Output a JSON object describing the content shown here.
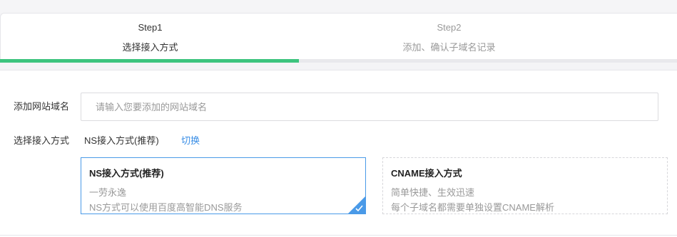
{
  "steps": [
    {
      "title": "Step1",
      "subtitle": "选择接入方式",
      "active": true
    },
    {
      "title": "Step2",
      "subtitle": "添加、确认子域名记录",
      "active": false
    }
  ],
  "progress": {
    "current_step": 1,
    "total_steps": 2,
    "color": "#3dc47e"
  },
  "form": {
    "domain_label": "添加网站域名",
    "domain_placeholder": "请输入您要添加的网站域名",
    "domain_value": "",
    "method_label": "选择接入方式",
    "method_value": "NS接入方式(推荐)",
    "switch_label": "切换"
  },
  "options": [
    {
      "title": "NS接入方式(推荐)",
      "line1": "一劳永逸",
      "line2": "NS方式可以使用百度高智能DNS服务",
      "selected": true
    },
    {
      "title": "CNAME接入方式",
      "line1": "简单快捷、生效迅速",
      "line2": "每个子域名都需要单独设置CNAME解析",
      "selected": false
    }
  ],
  "colors": {
    "accent": "#3a8ee6",
    "selected_border": "#4a9ae8",
    "progress": "#3dc47e"
  },
  "icons": {
    "selected_check": "check-icon"
  }
}
